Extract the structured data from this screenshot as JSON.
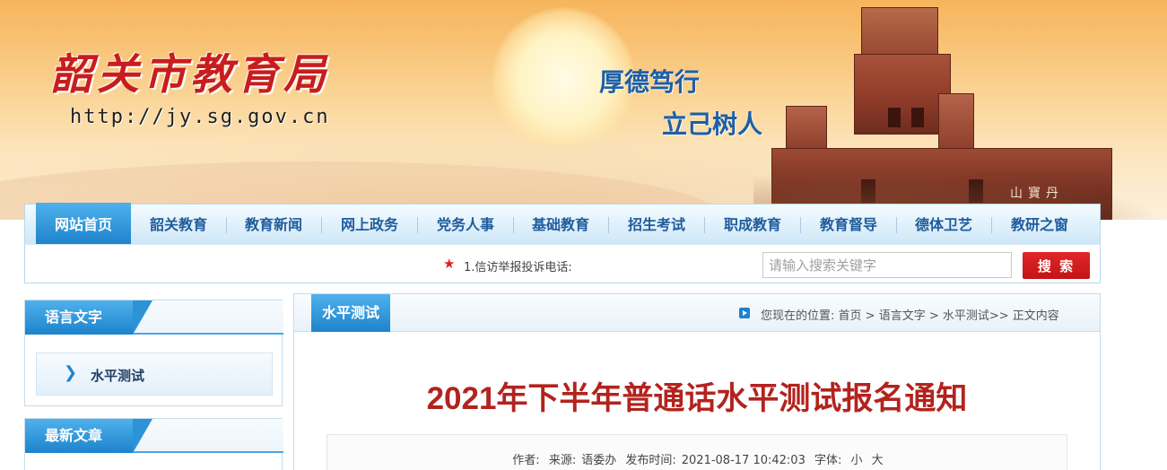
{
  "header": {
    "site_title": "韶关市教育局",
    "site_url": "http://jy.sg.gov.cn",
    "motto_line1": "厚德笃行",
    "motto_line2": "立己树人",
    "building_sign": "山寶丹"
  },
  "nav": {
    "items": [
      {
        "label": "网站首页",
        "active": true
      },
      {
        "label": "韶关教育",
        "active": false
      },
      {
        "label": "教育新闻",
        "active": false
      },
      {
        "label": "网上政务",
        "active": false
      },
      {
        "label": "党务人事",
        "active": false
      },
      {
        "label": "基础教育",
        "active": false
      },
      {
        "label": "招生考试",
        "active": false
      },
      {
        "label": "职成教育",
        "active": false
      },
      {
        "label": "教育督导",
        "active": false
      },
      {
        "label": "德体卫艺",
        "active": false
      },
      {
        "label": "教研之窗",
        "active": false
      }
    ]
  },
  "subbar": {
    "hotline": "1.信访举报投诉电话:",
    "star_icon": "star-icon",
    "search_placeholder": "请输入搜索关键字",
    "search_button": "搜 索"
  },
  "sidebar": {
    "section1_title": "语言文字",
    "section1_link": "水平测试",
    "section2_title": "最新文章",
    "section2_first_item": "..."
  },
  "main": {
    "tab_label": "水平测试",
    "breadcrumb_prefix": "您现在的位置:",
    "breadcrumb": "首页 > 语言文字 > 水平测试>> 正文内容",
    "article_title": "2021年下半年普通话水平测试报名通知",
    "meta": {
      "author_label": "作者:",
      "source_label": "来源:",
      "source_value": "语委办",
      "publish_label": "发布时间:",
      "publish_time": "2021-08-17 10:42:03",
      "font_label": "字体:",
      "font_small": "小",
      "font_large": "大"
    }
  },
  "colors": {
    "brand_red": "#c81d1d",
    "nav_blue": "#1d83cc",
    "title_red": "#b3231e",
    "motto_blue": "#1d5fa8"
  }
}
